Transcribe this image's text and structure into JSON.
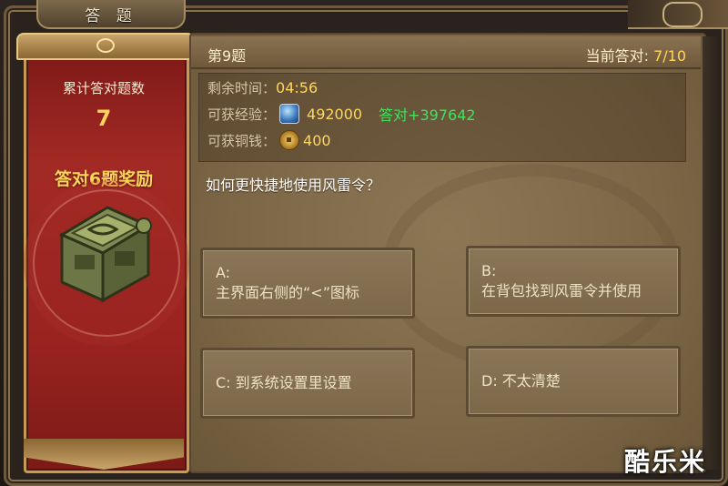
{
  "window": {
    "title": "答 题"
  },
  "sidebar": {
    "total_label": "累计答对题数",
    "total_value": "7",
    "reward_label": "答对6题奖励",
    "reward_icon": "treasure-chest-icon"
  },
  "question": {
    "number_label": "第9题",
    "progress_label": "当前答对:",
    "progress_value": "7/10",
    "time_label": "剩余时间：",
    "time_value": "04:56",
    "exp_label": "可获经验：",
    "exp_icon": "exp-gem-icon",
    "exp_value": "492000",
    "exp_bonus": "答对+397642",
    "coin_label": "可获铜钱：",
    "coin_icon": "copper-coin-icon",
    "coin_value": "400",
    "text": "如何更快捷地使用风雷令？"
  },
  "answers": [
    {
      "label": "A:",
      "text": "主界面右侧的“<”图标"
    },
    {
      "label": "B:",
      "text": "在背包找到风雷令并使用"
    },
    {
      "label": "C: 到系统设置里设置",
      "text": ""
    },
    {
      "label": "D: 不太清楚",
      "text": ""
    }
  ],
  "watermark": "酷乐米",
  "colors": {
    "accent_gold": "#ffd659",
    "bonus_green": "#3fe35c",
    "banner_red": "#a32a24"
  }
}
